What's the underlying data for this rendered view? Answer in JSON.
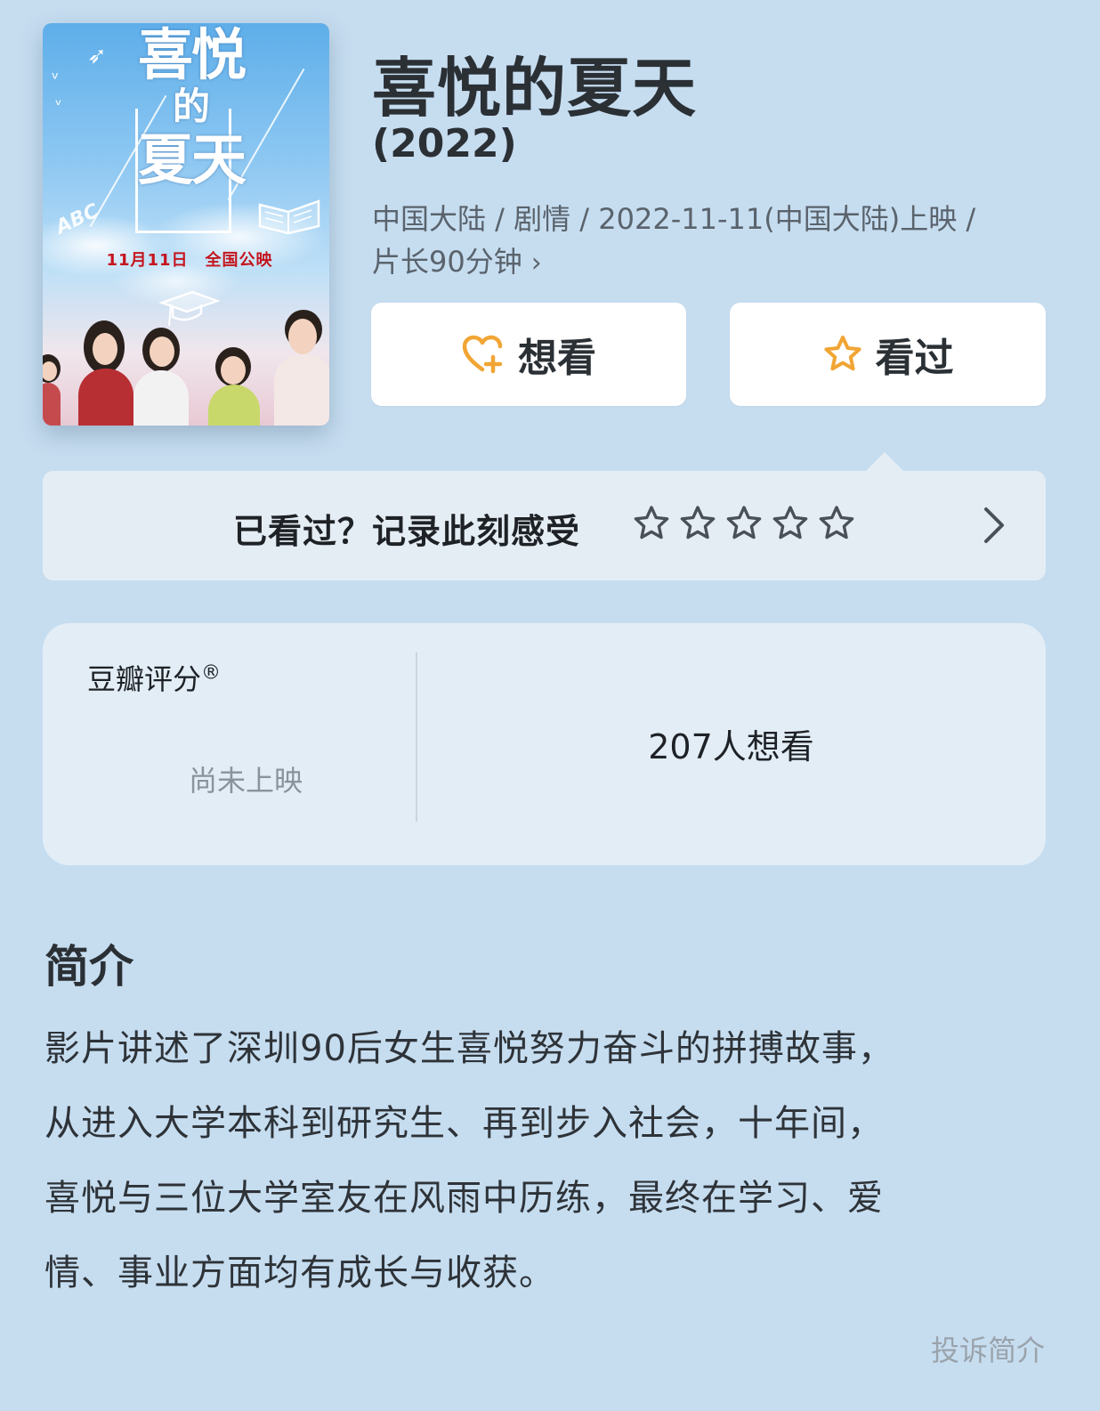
{
  "movie": {
    "title": "喜悦的夏天",
    "year": "(2022)",
    "meta_line1": "中国大陆 / 剧情 / 2022-11-11(中国大陆)上映 /",
    "meta_line2": "片长90分钟",
    "poster": {
      "title_line1": "喜悦",
      "title_line2": "的",
      "title_line3": "夏天",
      "date_text": "11月11日　全国公映",
      "abc_text": "ABC"
    }
  },
  "actions": {
    "want_label": "想看",
    "seen_label": "看过",
    "want_icon": "heart-plus-icon",
    "seen_icon": "star-outline-icon",
    "icon_color": "#f1a534"
  },
  "rate": {
    "prompt": "已看过？记录此刻感受",
    "stars_total": 5
  },
  "score": {
    "label": "豆瓣评分",
    "registered_mark": "®",
    "status": "尚未上映",
    "want_count": "207人想看"
  },
  "intro": {
    "heading": "简介",
    "lines": [
      "影片讲述了深圳90后女生喜悦努力奋斗的拼搏故事，",
      "从进入大学本科到研究生、再到步入社会，十年间，",
      "喜悦与三位大学室友在风雨中历练，最终在学习、爱",
      "情、事业方面均有成长与收获。"
    ],
    "report_label": "投诉简介"
  },
  "colors": {
    "background": "#c6ddf0",
    "card": "#e2edf6",
    "accent": "#f1a534"
  }
}
